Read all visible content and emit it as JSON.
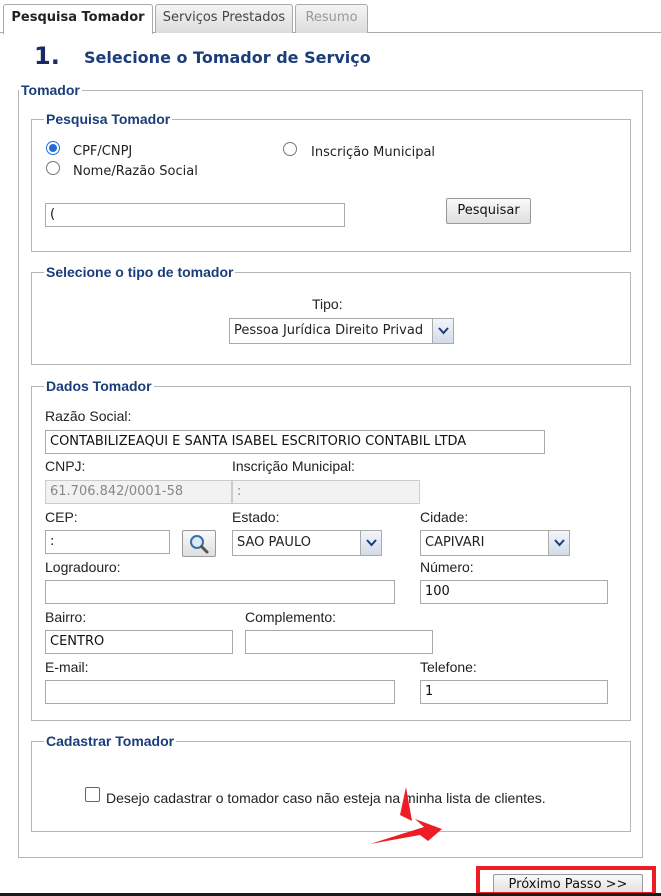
{
  "tabs": [
    {
      "label": "Pesquisa Tomador",
      "state": "active"
    },
    {
      "label": "Serviços Prestados",
      "state": "normal"
    },
    {
      "label": "Resumo",
      "state": "disabled"
    }
  ],
  "step": {
    "number": "1.",
    "title": "Selecione o Tomador de Serviço"
  },
  "tomador_legend": "Tomador",
  "search": {
    "legend": "Pesquisa Tomador",
    "options": [
      "CPF/CNPJ",
      "Inscrição Municipal",
      "Nome/Razão Social"
    ],
    "selected": "CPF/CNPJ",
    "value": "(",
    "button": "Pesquisar"
  },
  "tipo": {
    "legend": "Selecione o tipo de tomador",
    "label": "Tipo:",
    "selected": "Pessoa Jurídica Direito Privad"
  },
  "dados": {
    "legend": "Dados Tomador",
    "razao_label": "Razão Social:",
    "razao_value": "CONTABILIZEAQUI E SANTA ISABEL ESCRITORIO CONTABIL LTDA",
    "cnpj_label": "CNPJ:",
    "cnpj_value": "61.706.842/0001-58",
    "insc_label": "Inscrição Municipal:",
    "insc_value": ":",
    "cep_label": "CEP:",
    "cep_value": ":",
    "estado_label": "Estado:",
    "estado_value": "SAO PAULO",
    "cidade_label": "Cidade:",
    "cidade_value": "CAPIVARI",
    "logradouro_label": "Logradouro:",
    "logradouro_value": "",
    "numero_label": "Número:",
    "numero_value": "100",
    "bairro_label": "Bairro:",
    "bairro_value": "CENTRO",
    "complemento_label": "Complemento:",
    "complemento_value": "",
    "email_label": "E-mail:",
    "email_value": "",
    "telefone_label": "Telefone:",
    "telefone_value": "1"
  },
  "cadastrar": {
    "legend": "Cadastrar Tomador",
    "checkbox_label": "Desejo cadastrar o tomador caso não esteja na minha lista de clientes."
  },
  "next_button": "Próximo Passo >>",
  "colors": {
    "legend": "#1b3d7a",
    "radio": "#1e6fd9",
    "annotation": "#ee1c25"
  },
  "icons": {
    "cep_search": "magnifier-icon",
    "dropdown": "chevron-down-icon"
  }
}
